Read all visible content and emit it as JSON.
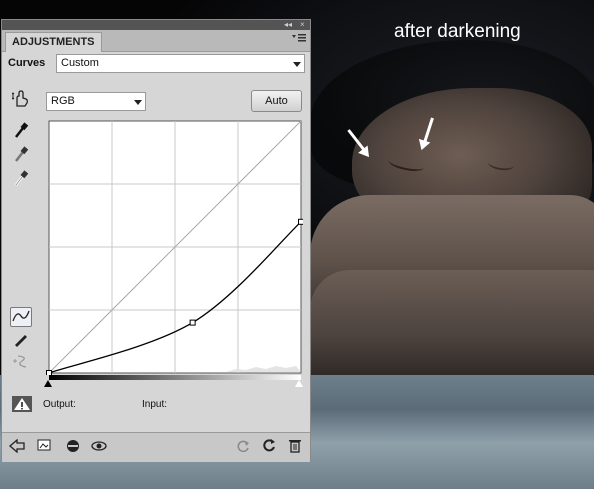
{
  "photo": {
    "caption": "after darkening"
  },
  "panel": {
    "strip_left": "◂◂",
    "strip_close": "×",
    "tab_label": "ADJUSTMENTS",
    "menu_icon": "menu-icon",
    "adjustment_type": "Curves",
    "preset_value": "Custom",
    "channel_value": "RGB",
    "auto_label": "Auto",
    "output_label": "Output:",
    "input_label": "Input:"
  },
  "curve": {
    "control_points": [
      [
        0,
        0
      ],
      [
        57,
        20
      ],
      [
        100,
        60
      ]
    ],
    "input_range": [
      0,
      100
    ],
    "output_range": [
      0,
      100
    ],
    "grid_divisions": 4
  },
  "colors": {
    "panel_bg": "#d6d6d6",
    "curve": "#000000",
    "grid": "#c8c8c8"
  }
}
